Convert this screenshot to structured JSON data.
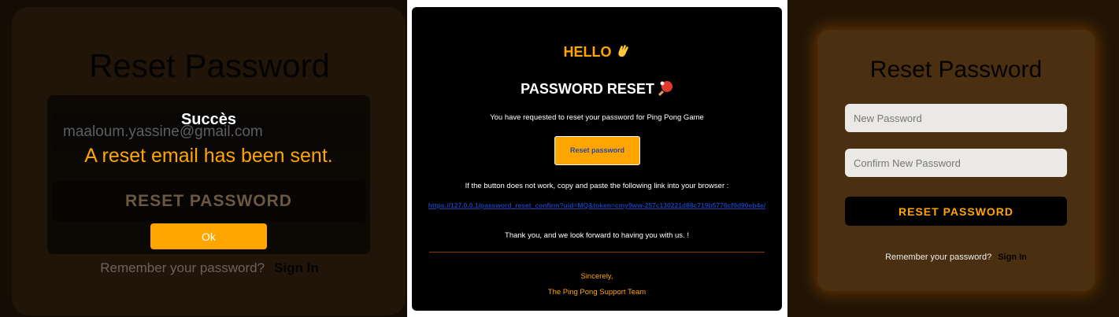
{
  "left": {
    "title": "Reset Password",
    "email_value": "maaloum.yassine@gmail.com",
    "button_label": "RESET PASSWORD",
    "remember_text": "Remember your password?",
    "sign_in": "Sign In",
    "modal": {
      "title": "Succès",
      "message": "A reset email has been sent.",
      "ok_label": "Ok"
    }
  },
  "email": {
    "hello": "HELLO",
    "hello_icon": "waving-hand",
    "heading": "PASSWORD RESET",
    "heading_icon": "ping-pong-paddle",
    "request_text": "You have requested to reset your password for Ping Pong Game",
    "button_label": "Reset password",
    "fallback_text": "If the button does not work, copy and paste the following link into your browser :",
    "link": "https://127.0.0.1/password_reset_confirm?uid=MQ&token=cmy9ww-257c130221d88c719b5776cf9d90eb4e/",
    "thanks": "Thank you, and we look forward to having you with us. !",
    "signoff": "Sincerely,",
    "team": "The Ping Pong Support Team"
  },
  "right": {
    "title": "Reset Password",
    "new_password_placeholder": "New Password",
    "confirm_password_placeholder": "Confirm New Password",
    "button_label": "RESET PASSWORD",
    "remember_text": "Remember your password?",
    "sign_in": "Sign In"
  },
  "colors": {
    "accent": "#ffa500",
    "link": "#1a3fa8"
  }
}
